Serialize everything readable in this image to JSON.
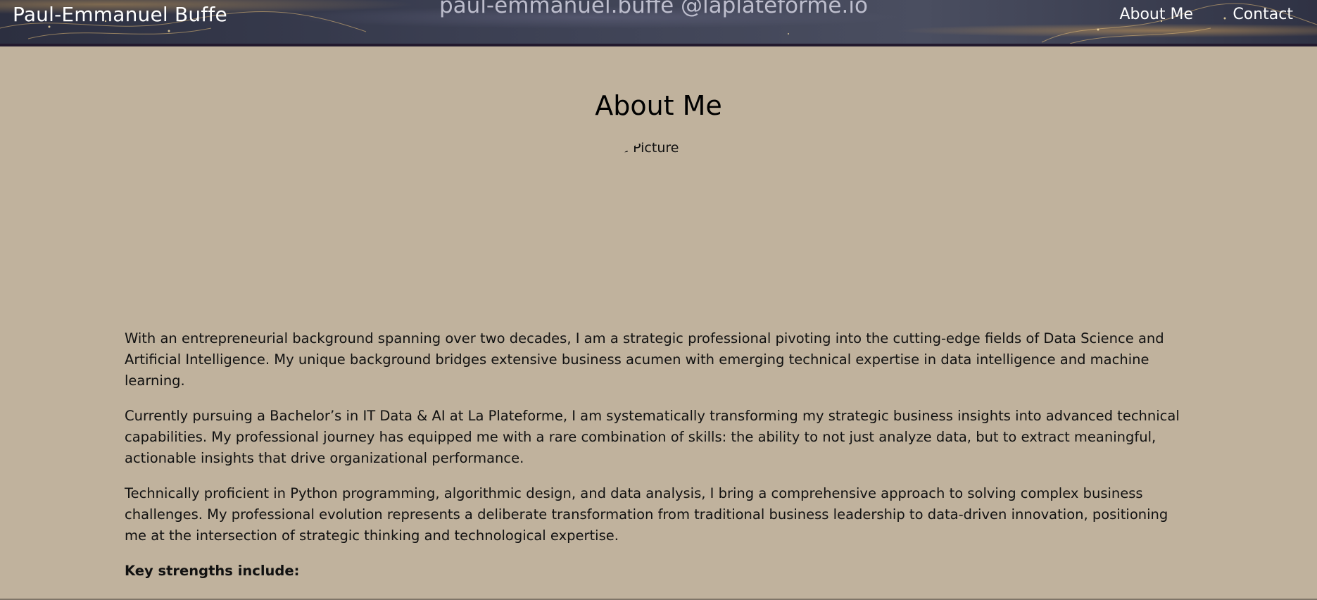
{
  "header": {
    "brand": "Paul-Emmanuel Buffe",
    "email": "paul-emmanuel.buffe @laplateforme.io",
    "nav": {
      "about_label": "About Me",
      "contact_label": "Contact"
    }
  },
  "main": {
    "title": "About Me",
    "profile_alt": "Profile Picture",
    "paragraphs": [
      "With an entrepreneurial background spanning over two decades, I am a strategic professional pivoting into the cutting-edge fields of Data Science and Artificial Intelligence. My unique background bridges extensive business acumen with emerging technical expertise in data intelligence and machine learning.",
      "Currently pursuing a Bachelor’s in IT Data & AI at La Plateforme, I am systematically transforming my strategic business insights into advanced technical capabilities. My professional journey has equipped me with a rare combination of skills: the ability to not just analyze data, but to extract meaningful, actionable insights that drive organizational performance.",
      "Technically proficient in Python programming, algorithmic design, and data analysis, I bring a comprehensive approach to solving complex business challenges. My professional evolution represents a deliberate transformation from traditional business leadership to data-driven innovation, positioning me at the intersection of strategic thinking and technological expertise."
    ],
    "strengths_heading": "Key strengths include:"
  },
  "colors": {
    "page_background": "#c0b29d",
    "header_background": "#3d4154",
    "header_border": "#231a2e",
    "text": "#111111",
    "header_text": "#ffffff"
  }
}
